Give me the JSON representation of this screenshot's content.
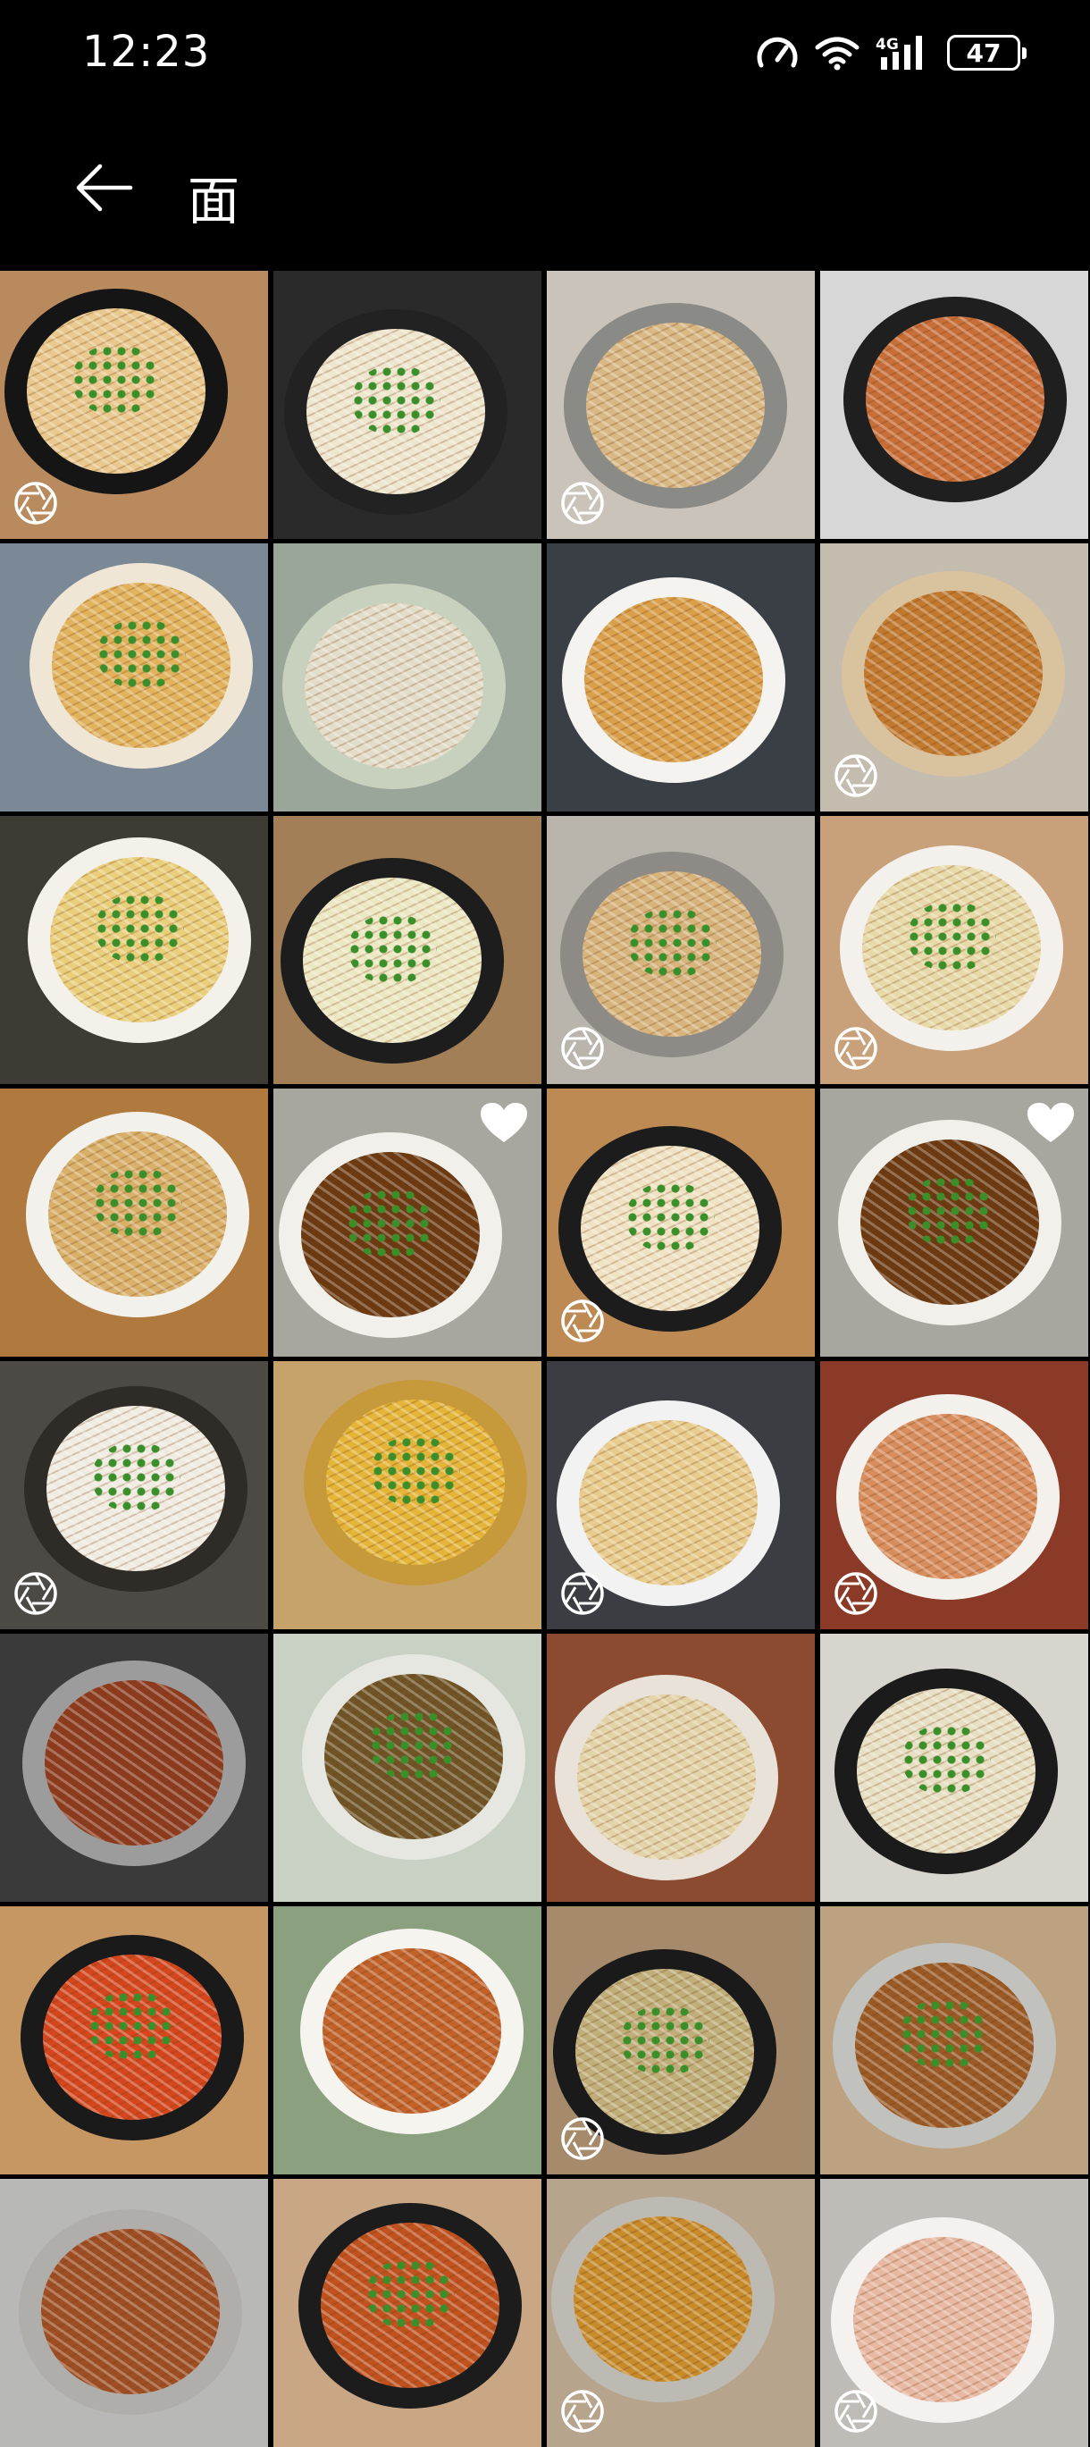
{
  "status_bar": {
    "time": "12:23",
    "network": "4G",
    "battery": "47",
    "icons": [
      "speed-icon",
      "wifi-icon",
      "signal-4g-icon",
      "battery-icon"
    ]
  },
  "app_bar": {
    "back_icon": "arrow-left-icon",
    "title": "面"
  },
  "grid": {
    "photos": [
      {
        "bg": "#b98a5e",
        "plate": "#151515",
        "noodle": "#e9c98d",
        "garnish": true,
        "live": true,
        "heart": false
      },
      {
        "bg": "#2a2a2a",
        "plate": "#222222",
        "noodle": "#efe6cf",
        "garnish": true,
        "live": false,
        "heart": false
      },
      {
        "bg": "#c9c3b9",
        "plate": "#8a8a86",
        "noodle": "#d8b885",
        "garnish": false,
        "live": true,
        "heart": false
      },
      {
        "bg": "#d7d7d7",
        "plate": "#1f1f1f",
        "noodle": "#c86e39",
        "garnish": false,
        "live": false,
        "heart": false
      },
      {
        "bg": "#7b8895",
        "plate": "#f0e6d5",
        "noodle": "#e2b35e",
        "garnish": true,
        "live": false,
        "heart": false
      },
      {
        "bg": "#9aa69a",
        "plate": "#c7d1bd",
        "noodle": "#e3dcc8",
        "garnish": false,
        "live": false,
        "heart": false
      },
      {
        "bg": "#3a3f46",
        "plate": "#f5f3ef",
        "noodle": "#d99f4a",
        "garnish": false,
        "live": false,
        "heart": false
      },
      {
        "bg": "#c5bcb0",
        "plate": "#d9c29e",
        "noodle": "#c1792f",
        "garnish": false,
        "live": true,
        "heart": false
      },
      {
        "bg": "#3e3b35",
        "plate": "#f4f1ea",
        "noodle": "#e9cf7b",
        "garnish": true,
        "live": false,
        "heart": false
      },
      {
        "bg": "#a37f58",
        "plate": "#1d1d1d",
        "noodle": "#ede8c4",
        "garnish": true,
        "live": false,
        "heart": false
      },
      {
        "bg": "#b9b5ad",
        "plate": "#8e8b86",
        "noodle": "#d8b47d",
        "garnish": true,
        "live": true,
        "heart": false
      },
      {
        "bg": "#c8a07a",
        "plate": "#f4f1ec",
        "noodle": "#e8d9a8",
        "garnish": true,
        "live": true,
        "heart": false
      },
      {
        "bg": "#b07a3e",
        "plate": "#f3f1ec",
        "noodle": "#d8b06a",
        "garnish": true,
        "live": false,
        "heart": false
      },
      {
        "bg": "#a8a79f",
        "plate": "#f2f0eb",
        "noodle": "#6b3a12",
        "garnish": true,
        "live": false,
        "heart": true
      },
      {
        "bg": "#bd8a54",
        "plate": "#1c1c1c",
        "noodle": "#f0e3c3",
        "garnish": true,
        "live": true,
        "heart": false
      },
      {
        "bg": "#a8a79f",
        "plate": "#f2f0eb",
        "noodle": "#6b3a12",
        "garnish": true,
        "live": false,
        "heart": true
      },
      {
        "bg": "#4d4a45",
        "plate": "#2f2b27",
        "noodle": "#f0ece2",
        "garnish": true,
        "live": true,
        "heart": false
      },
      {
        "bg": "#c7a36c",
        "plate": "#c69a3a",
        "noodle": "#e5b53a",
        "garnish": true,
        "live": false,
        "heart": false
      },
      {
        "bg": "#3b3d42",
        "plate": "#f2f2f2",
        "noodle": "#e8cc8e",
        "garnish": false,
        "live": true,
        "heart": false
      },
      {
        "bg": "#8b3a28",
        "plate": "#f4f1ec",
        "noodle": "#d88d5d",
        "garnish": false,
        "live": true,
        "heart": false
      },
      {
        "bg": "#3a3a3a",
        "plate": "#9c9c9c",
        "noodle": "#8c3b1f",
        "garnish": false,
        "live": false,
        "heart": false
      },
      {
        "bg": "#c9d0c4",
        "plate": "#e7e7e1",
        "noodle": "#6e5426",
        "garnish": true,
        "live": false,
        "heart": false
      },
      {
        "bg": "#8c4b30",
        "plate": "#e8e2d8",
        "noodle": "#e3d3a8",
        "garnish": false,
        "live": false,
        "heart": false
      },
      {
        "bg": "#d8d5ce",
        "plate": "#1b1b1b",
        "noodle": "#e8e0c4",
        "garnish": true,
        "live": false,
        "heart": false
      },
      {
        "bg": "#c79763",
        "plate": "#1a1a1a",
        "noodle": "#d4471e",
        "garnish": true,
        "live": false,
        "heart": false
      },
      {
        "bg": "#8aa07f",
        "plate": "#f5f4ef",
        "noodle": "#c1622a",
        "garnish": false,
        "live": false,
        "heart": false
      },
      {
        "bg": "#a58b6b",
        "plate": "#1a1a1a",
        "noodle": "#bfae7a",
        "garnish": true,
        "live": true,
        "heart": false
      },
      {
        "bg": "#bda282",
        "plate": "#c1c1be",
        "noodle": "#9a5a26",
        "garnish": true,
        "live": false,
        "heart": false
      },
      {
        "bg": "#b8b8b6",
        "plate": "#b0aeaa",
        "noodle": "#9e4e24",
        "garnish": false,
        "live": false,
        "heart": false
      },
      {
        "bg": "#c9a785",
        "plate": "#1c1c1c",
        "noodle": "#c0521f",
        "garnish": true,
        "live": false,
        "heart": false
      },
      {
        "bg": "#b7a48c",
        "plate": "#bdbab4",
        "noodle": "#c78b2b",
        "garnish": false,
        "live": true,
        "heart": false
      },
      {
        "bg": "#bfbcb8",
        "plate": "#f4f1ee",
        "noodle": "#e7b8a2",
        "garnish": false,
        "live": true,
        "heart": false
      }
    ]
  }
}
